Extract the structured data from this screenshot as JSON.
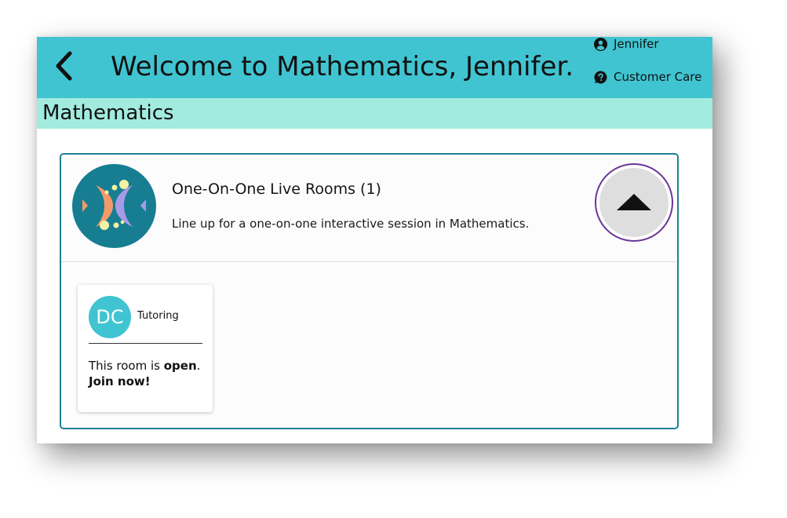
{
  "header": {
    "title": "Welcome to Mathematics, Jennifer.",
    "user_name": "Jennifer",
    "customer_care": "Customer Care",
    "back_icon": "chevron-left-icon",
    "bg_color": "#40c4d1"
  },
  "subject": {
    "title": "Mathematics",
    "bg_color": "#a2ebdf"
  },
  "room_section": {
    "heading": "One-On-One Live Rooms (1)",
    "description": "Line up for a one-on-one interactive session in Mathematics.",
    "logo_icon": "fish-logo-icon",
    "toggle_icon": "triangle-up-icon",
    "border_color": "#1f7f93"
  },
  "rooms": [
    {
      "initials": "DC",
      "type": "Tutoring",
      "status_prefix": "This room is ",
      "status_value": "open",
      "status_suffix": ".",
      "action": "Join now!",
      "avatar_color": "#40c4d1"
    }
  ]
}
